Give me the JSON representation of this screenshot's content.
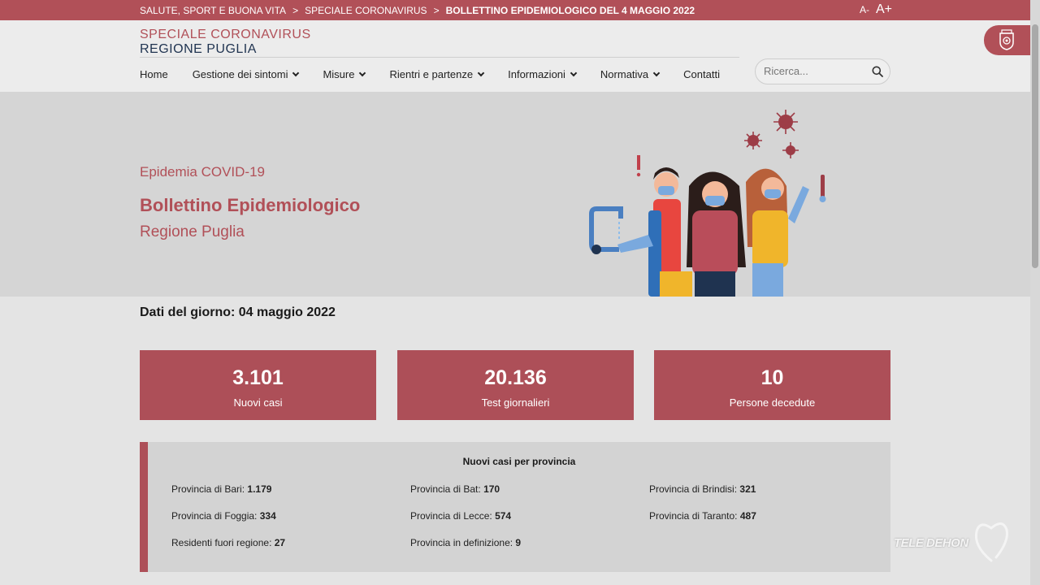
{
  "breadcrumb": {
    "items": [
      "SALUTE, SPORT E BUONA VITA",
      "SPECIALE CORONAVIRUS",
      "BOLLETTINO EPIDEMIOLOGICO DEL 4 MAGGIO 2022"
    ],
    "separator": ">"
  },
  "font_controls": {
    "decrease": "A-",
    "increase": "A+"
  },
  "brand": {
    "line1": "SPECIALE CORONAVIRUS",
    "line2": "REGIONE PUGLIA"
  },
  "nav": {
    "items": [
      {
        "label": "Home",
        "has_dropdown": false
      },
      {
        "label": "Gestione dei sintomi",
        "has_dropdown": true
      },
      {
        "label": "Misure",
        "has_dropdown": true
      },
      {
        "label": "Rientri e partenze",
        "has_dropdown": true
      },
      {
        "label": "Informazioni",
        "has_dropdown": true
      },
      {
        "label": "Normativa",
        "has_dropdown": true
      },
      {
        "label": "Contatti",
        "has_dropdown": false
      }
    ]
  },
  "search": {
    "placeholder": "Ricerca...",
    "value": ""
  },
  "hero": {
    "kicker": "Epidemia COVID-19",
    "title": "Bollettino Epidemiologico",
    "subtitle": "Regione Puglia"
  },
  "date_line": "Dati del giorno: 04 maggio 2022",
  "stats": [
    {
      "value": "3.101",
      "label": "Nuovi casi"
    },
    {
      "value": "20.136",
      "label": "Test giornalieri"
    },
    {
      "value": "10",
      "label": "Persone decedute"
    }
  ],
  "provinces": {
    "title": "Nuovi casi per provincia",
    "items": [
      {
        "label": "Provincia di Bari:",
        "value": "1.179"
      },
      {
        "label": "Provincia di Bat:",
        "value": "170"
      },
      {
        "label": "Provincia di Brindisi:",
        "value": "321"
      },
      {
        "label": "Provincia di Foggia:",
        "value": "334"
      },
      {
        "label": "Provincia di Lecce:",
        "value": "574"
      },
      {
        "label": "Provincia di Taranto:",
        "value": "487"
      },
      {
        "label": "Residenti fuori regione:",
        "value": "27"
      },
      {
        "label": "Provincia in definizione:",
        "value": "9"
      }
    ]
  },
  "watermark": "TELE DEHON",
  "colors": {
    "accent": "#b15058",
    "card": "#ad4f58",
    "brand_dark": "#1f3350"
  },
  "icons": [
    "search-icon",
    "chevron-down-icon",
    "region-seal-icon",
    "covid-illustration",
    "heart-logo-icon"
  ]
}
